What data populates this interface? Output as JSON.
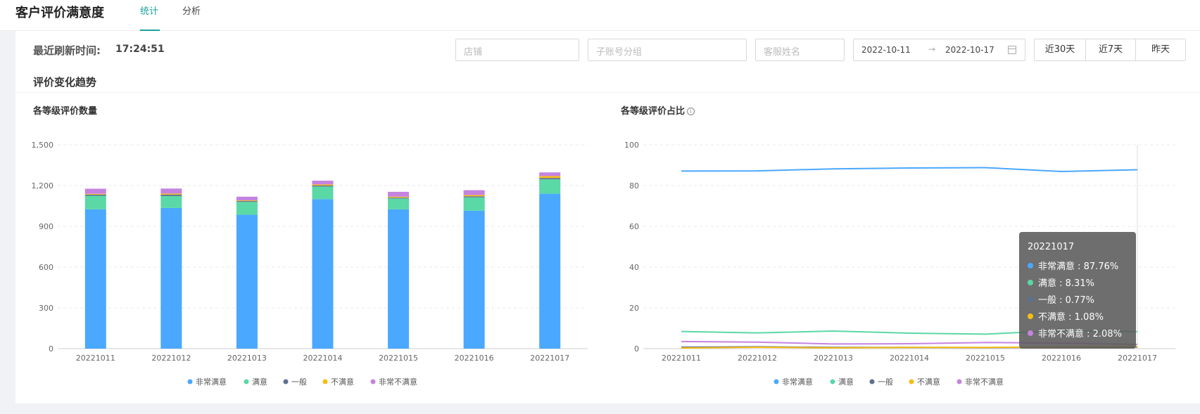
{
  "header": {
    "title": "客户评价满意度",
    "tabs": [
      {
        "label": "统计"
      },
      {
        "label": "分析"
      }
    ]
  },
  "toolbar": {
    "refresh_label": "最近刷新时间:",
    "refresh_time": "17:24:51",
    "shop_placeholder": "店铺",
    "subaccount_placeholder": "子账号分组",
    "agent_placeholder": "客服姓名",
    "date_start": "2022-10-11",
    "date_separator": "→",
    "date_end": "2022-10-17",
    "quick_ranges": [
      "近30天",
      "近7天",
      "昨天"
    ]
  },
  "section": {
    "title": "评价变化趋势"
  },
  "colors": {
    "very_satisfied": "#4aa8ff",
    "satisfied": "#5ad8a6",
    "neutral": "#5d7092",
    "unsatisfied": "#f6bd16",
    "very_unsatisfied": "#c583e0",
    "accent": "#1aa39a"
  },
  "chart_data": [
    {
      "type": "bar",
      "stacked": true,
      "title": "各等级评价数量",
      "categories": [
        "20221011",
        "20221012",
        "20221013",
        "20221014",
        "20221015",
        "20221016",
        "20221017"
      ],
      "series": [
        {
          "name": "非常满意",
          "values": [
            1025,
            1035,
            985,
            1100,
            1025,
            1015,
            1140
          ]
        },
        {
          "name": "满意",
          "values": [
            100,
            88,
            95,
            93,
            80,
            98,
            106
          ]
        },
        {
          "name": "一般",
          "values": [
            8,
            10,
            6,
            7,
            6,
            8,
            10
          ]
        },
        {
          "name": "不满意",
          "values": [
            6,
            8,
            5,
            8,
            7,
            9,
            14
          ]
        },
        {
          "name": "非常不满意",
          "values": [
            38,
            37,
            27,
            28,
            36,
            36,
            27
          ]
        }
      ],
      "yticks": [
        "0",
        "300",
        "600",
        "900",
        "1,200",
        "1,500"
      ],
      "ylim": [
        0,
        1500
      ],
      "grid": true,
      "legend": "bottom"
    },
    {
      "type": "line",
      "title": "各等级评价占比",
      "categories": [
        "20221011",
        "20221012",
        "20221013",
        "20221014",
        "20221015",
        "20221016",
        "20221017"
      ],
      "series": [
        {
          "name": "非常满意",
          "values": [
            87.1,
            87.2,
            88.2,
            88.6,
            88.8,
            86.9,
            87.76
          ]
        },
        {
          "name": "满意",
          "values": [
            8.4,
            7.7,
            8.6,
            7.6,
            7.1,
            8.9,
            8.31
          ]
        },
        {
          "name": "一般",
          "values": [
            0.7,
            0.9,
            0.6,
            0.6,
            0.5,
            0.7,
            0.77
          ]
        },
        {
          "name": "不满意",
          "values": [
            0.3,
            0.7,
            0.4,
            0.6,
            0.6,
            0.8,
            1.08
          ]
        },
        {
          "name": "非常不满意",
          "values": [
            3.5,
            3.2,
            2.3,
            2.4,
            3.0,
            2.7,
            2.08
          ]
        }
      ],
      "yticks": [
        "0",
        "20",
        "40",
        "60",
        "80",
        "100"
      ],
      "ylim": [
        0,
        100
      ],
      "grid": true,
      "legend": "bottom",
      "tooltip": {
        "title": "20221017",
        "rows": [
          "非常满意 : 87.76%",
          "满意 : 8.31%",
          "一般 : 0.77%",
          "不满意 : 1.08%",
          "非常不满意 : 2.08%"
        ]
      }
    }
  ]
}
